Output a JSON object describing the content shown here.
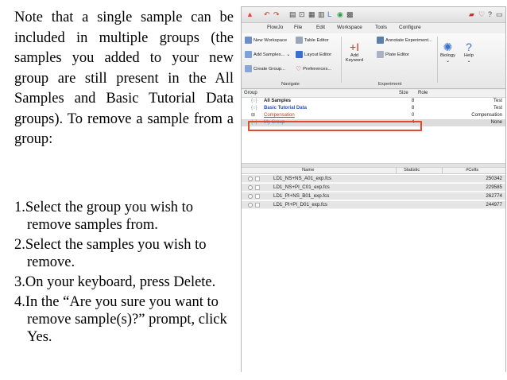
{
  "slide": {
    "intro": "Note that a single sample can be included in multiple groups (the samples  you added to your new group are still present in the All Samples and Basic  Tutorial Data groups). To remove a sample from a group:",
    "steps": [
      "1.Select the group you wish to remove samples from.",
      "2.Select the samples you wish to remove.",
      "3.On your keyboard, press Delete.",
      "4.In the “Are you sure you want to remove sample(s)?” prompt, click Yes."
    ]
  },
  "app": {
    "menu": [
      "FlowJo",
      "File",
      "Edit",
      "Workspace",
      "Tools",
      "Configure"
    ],
    "ribbon": {
      "new_workspace": "New Workspace",
      "table_editor": "Table Editor",
      "annotate_experiment": "Annotate Experiment...",
      "add_samples": "Add Samples...",
      "layout_editor": "Layout Editor",
      "plate_editor": "Plate Editor",
      "create_group": "Create Group...",
      "preferences": "Preferences...",
      "add_keyword": "Add Keyword",
      "biology": "Biology",
      "help": "Help",
      "navigate_label": "Navigate",
      "experiment_label": "Experiment"
    },
    "groups_table": {
      "headers": {
        "group": "Group",
        "size": "Size",
        "role": "Role"
      },
      "rows": [
        {
          "name": "All Samples",
          "size": "8",
          "role": "Test"
        },
        {
          "name": "Basic Tutorial Data",
          "size": "8",
          "role": "Test"
        },
        {
          "name": "Compensation",
          "size": "0",
          "role": "Compensation"
        },
        {
          "name": "My Group",
          "size": "4",
          "role": "None"
        }
      ]
    },
    "samples_table": {
      "headers": {
        "name": "Name",
        "statistic": "Statistic",
        "cells": "#Cells"
      },
      "rows": [
        {
          "name": "LD1_NS+NS_A01_exp.fcs",
          "statistic": "",
          "cells": "250342"
        },
        {
          "name": "LD1_NS+PI_C01_exp.fcs",
          "statistic": "",
          "cells": "229585"
        },
        {
          "name": "LD1_PI+NS_B01_exp.fcs",
          "statistic": "",
          "cells": "262774"
        },
        {
          "name": "LD1_PI+PI_D01_exp.fcs",
          "statistic": "",
          "cells": "244977"
        }
      ]
    },
    "colors": {
      "selection_highlight": "#e24a2b",
      "group_link_blue": "#2a52be",
      "compensation_red": "#c0392b",
      "my_group_blue": "#3f7fd6"
    }
  }
}
